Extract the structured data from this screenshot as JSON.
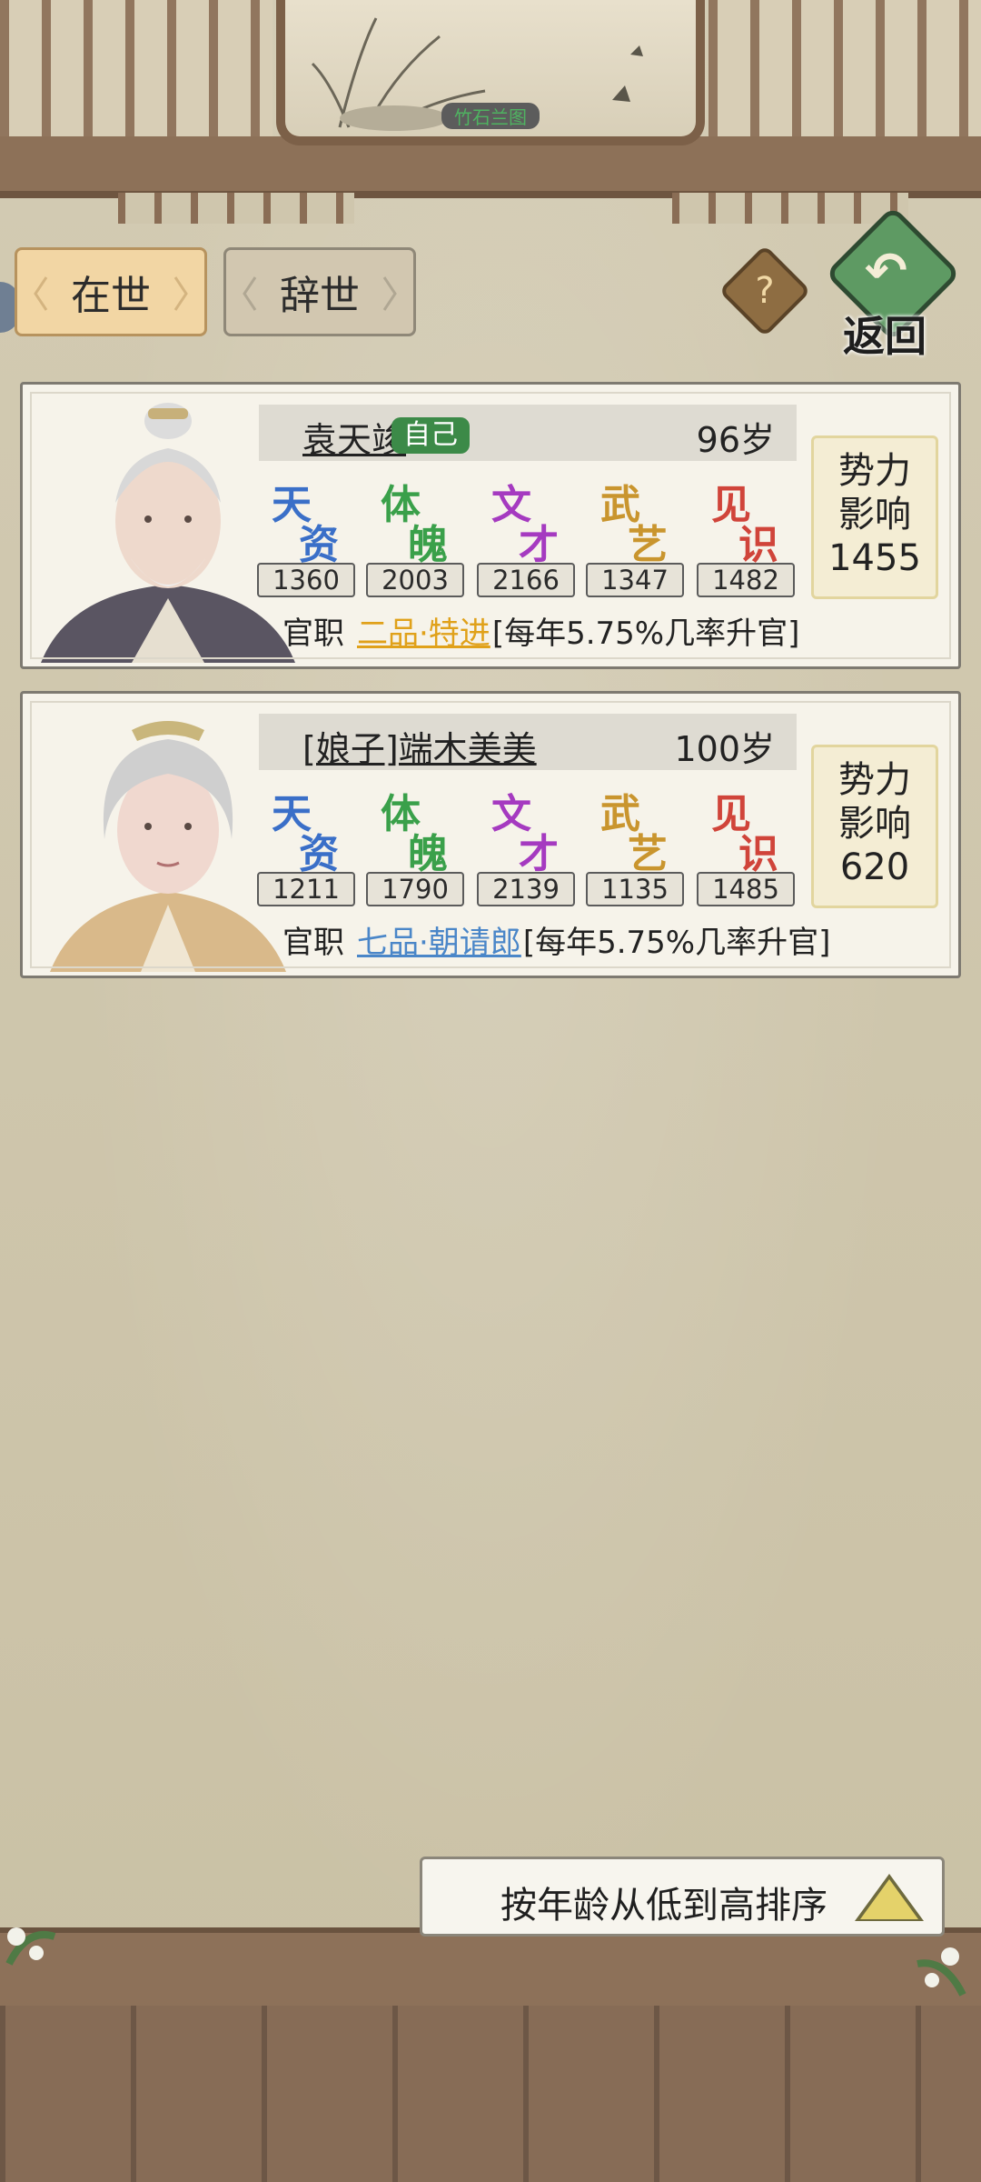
{
  "painting": {
    "label": "竹石兰图"
  },
  "tabs": [
    {
      "label": "在世",
      "selected": true
    },
    {
      "label": "辞世",
      "selected": false
    }
  ],
  "help": {
    "symbol": "?"
  },
  "back": {
    "label": "返回"
  },
  "attributes": [
    {
      "c1": "天",
      "c2": "资",
      "color": "#3a6fc8"
    },
    {
      "c1": "体",
      "c2": "魄",
      "color": "#3aa04a"
    },
    {
      "c1": "文",
      "c2": "才",
      "color": "#a53ac0"
    },
    {
      "c1": "武",
      "c2": "艺",
      "color": "#c9952e"
    },
    {
      "c1": "见",
      "c2": "识",
      "color": "#d0443a"
    }
  ],
  "persons": [
    {
      "name": "袁天竣",
      "self_badge": "自己",
      "age": "96岁",
      "stats": [
        "1360",
        "2003",
        "2166",
        "1347",
        "1482"
      ],
      "official_label": "官职",
      "rank": "二品·特进",
      "rank_color": "#e0a11a",
      "promotion": "[每年5.75%几率升官]",
      "influence_label_1": "势力",
      "influence_label_2": "影响",
      "influence": "1455"
    },
    {
      "name": "[娘子]端木美美",
      "self_badge": "",
      "age": "100岁",
      "stats": [
        "1211",
        "1790",
        "2139",
        "1135",
        "1485"
      ],
      "official_label": "官职",
      "rank": "七品·朝请郎",
      "rank_color": "#4a86c8",
      "promotion": "[每年5.75%几率升官]",
      "influence_label_1": "势力",
      "influence_label_2": "影响",
      "influence": "620"
    }
  ],
  "sort": {
    "label": "按年龄从低到高排序"
  }
}
